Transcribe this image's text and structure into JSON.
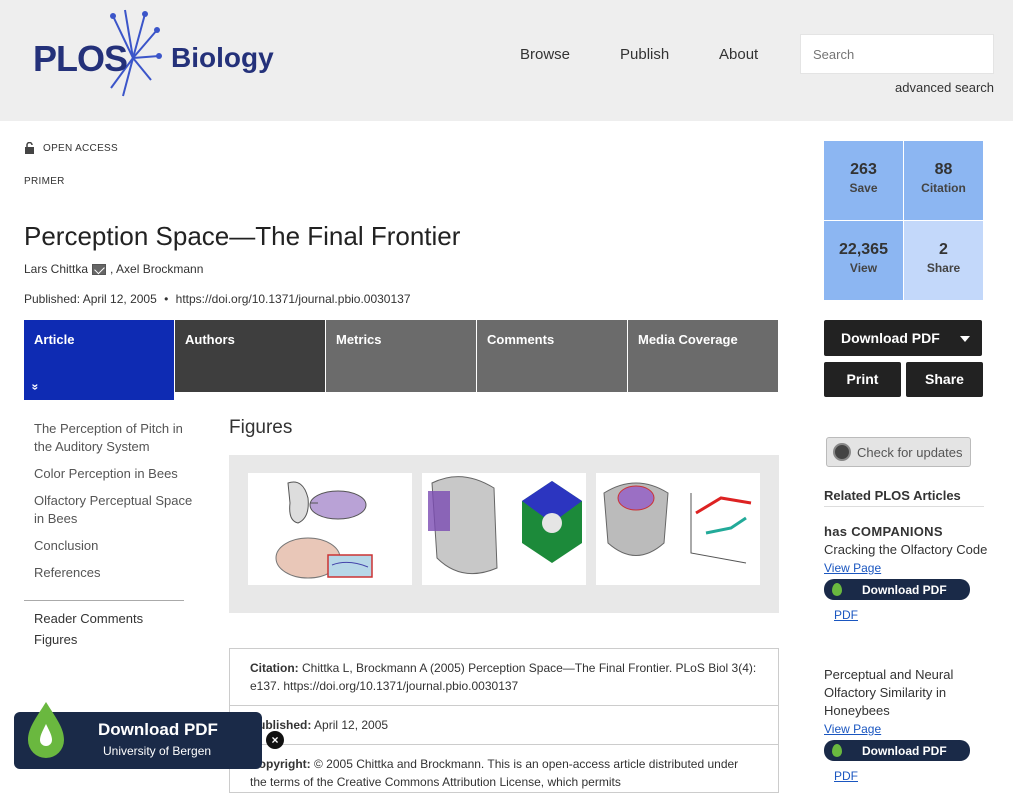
{
  "header": {
    "logo_plos": "PLOS",
    "logo_journal": "Biology",
    "nav": [
      "Browse",
      "Publish",
      "About"
    ],
    "search_placeholder": "Search",
    "advanced_search": "advanced search"
  },
  "article": {
    "access": "OPEN ACCESS",
    "type": "PRIMER",
    "title": "Perception Space—The Final Frontier",
    "author1": "Lars Chittka",
    "author2": ", Axel Brockmann",
    "published": "Published: April 12, 2005",
    "bullet": "•",
    "doi": "https://doi.org/10.1371/journal.pbio.0030137"
  },
  "tabs": [
    "Article",
    "Authors",
    "Metrics",
    "Comments",
    "Media Coverage"
  ],
  "tab_chevron": "»",
  "toc": [
    "The Perception of Pitch in the Auditory System",
    "Color Perception in Bees",
    "Olfactory Perceptual Space in Bees",
    "Conclusion",
    "References"
  ],
  "toc2": [
    "Reader Comments",
    "Figures"
  ],
  "figures_heading": "Figures",
  "citation": {
    "cit_label": "Citation:",
    "cit_text": " Chittka L, Brockmann A (2005) Perception Space—The Final Frontier. PLoS Biol 3(4): e137. https://doi.org/10.1371/journal.pbio.0030137",
    "pub_label": "Published:",
    "pub_text": " April 12, 2005",
    "copy_label": "Copyright:",
    "copy_text": " © 2005 Chittka and Brockmann. This is an open-access article distributed under the terms of the Creative Commons Attribution License, which permits"
  },
  "metrics": [
    {
      "num": "263",
      "label": "Save"
    },
    {
      "num": "88",
      "label": "Citation"
    },
    {
      "num": "22,365",
      "label": "View"
    },
    {
      "num": "2",
      "label": "Share"
    }
  ],
  "actions": {
    "download_pdf": "Download PDF",
    "print": "Print",
    "share": "Share"
  },
  "check_updates": "Check for updates",
  "related": {
    "heading": "Related PLOS Articles",
    "tag": "has COMPANIONS",
    "items": [
      {
        "title": "Cracking the Olfactory Code",
        "view": "View Page",
        "dl": "Download PDF",
        "pdf": "PDF"
      },
      {
        "title": "Perceptual and Neural Olfactory Similarity in Honeybees",
        "view": "View Page",
        "dl": "Download PDF",
        "pdf": "PDF"
      }
    ]
  },
  "floating": {
    "title": "Download PDF",
    "subtitle": "University of Bergen",
    "close": "×"
  },
  "colors": {
    "brand": "#24317a",
    "active_tab": "#0e2bb3",
    "tab": "#6b6b6b",
    "metric_blue": "#8cb6f2",
    "metric_light": "#c3d8fa"
  }
}
